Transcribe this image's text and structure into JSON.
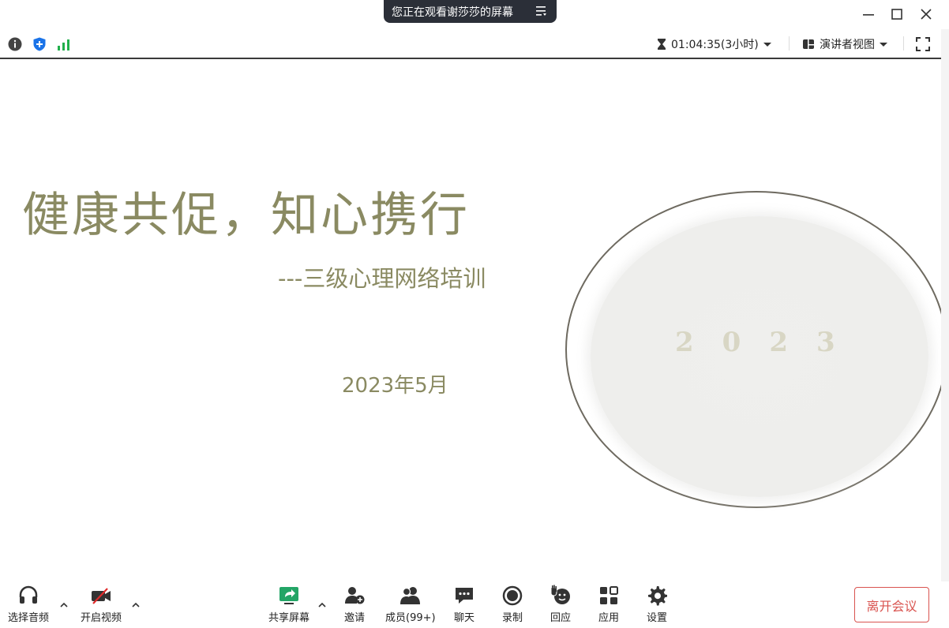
{
  "title_bar": {
    "share_notice": "您正在观看谢莎莎的屏幕"
  },
  "info_bar": {
    "timer": "01:04:35(3小时)",
    "view_mode": "演讲者视图"
  },
  "slide": {
    "title": "健康共促，知心携行",
    "subtitle": "---三级心理网络培训",
    "date": "2023年5月",
    "year_digits": "2023"
  },
  "toolbar": {
    "audio": "选择音频",
    "video": "开启视频",
    "share": "共享屏幕",
    "invite": "邀请",
    "participants": "成员(99+)",
    "chat": "聊天",
    "record": "录制",
    "reactions": "回应",
    "apps": "应用",
    "settings": "设置",
    "leave": "离开会议"
  },
  "colors": {
    "share_green": "#23a566",
    "leave_red": "#d9534f",
    "slide_text": "#8a8a62",
    "shield_blue": "#1a73e8",
    "signal_green": "#22b04c"
  }
}
